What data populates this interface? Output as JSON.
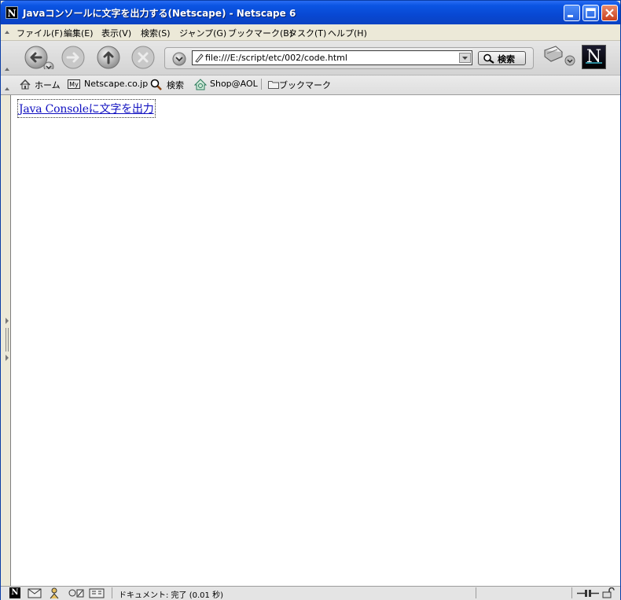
{
  "window": {
    "title": "Javaコンソールに文字を出力する(Netscape) - Netscape 6",
    "app_icon_letter": "N"
  },
  "menubar": {
    "items": [
      "ファイル(F)",
      "編集(E)",
      "表示(V)",
      "検索(S)",
      "ジャンプ(G)",
      "ブックマーク(B)",
      "タスク(T)",
      "ヘルプ(H)"
    ]
  },
  "navigation": {
    "url": "file:///E:/script/etc/002/code.html",
    "search_label": "検索",
    "brand_letter": "N"
  },
  "bookmarks": {
    "items": [
      "ホーム",
      "Netscape.co.jp",
      "検索",
      "Shop@AOL",
      "ブックマーク"
    ],
    "my_badge": "My"
  },
  "content": {
    "link_text": "Java Consoleに文字を出力"
  },
  "statusbar": {
    "text": "ドキュメント: 完了 (0.01 秒)"
  },
  "colors": {
    "titlebar": "#0b55e3",
    "link": "#1010c0"
  }
}
